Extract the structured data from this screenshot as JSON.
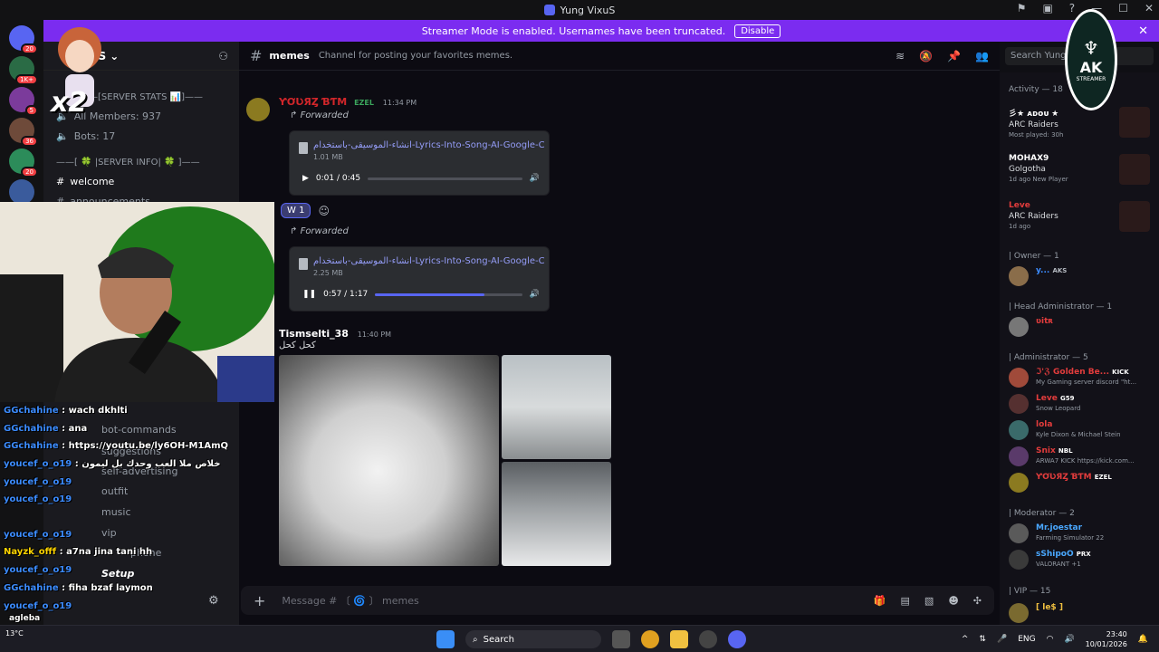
{
  "window": {
    "title": "Yung VixuS"
  },
  "banner": {
    "text": "Streamer Mode is enabled. Usernames have been truncated.",
    "button": "Disable"
  },
  "guilds": [
    {
      "badge": "20",
      "color": "#5865f2"
    },
    {
      "badge": "1K+",
      "color": "#2a6b45"
    },
    {
      "badge": "5",
      "color": "#7b3b9b"
    },
    {
      "badge": "36",
      "color": "#6e4a3a"
    },
    {
      "badge": "20",
      "color": "#2c8c5a"
    },
    {
      "badge": "",
      "color": "#3a5b9c"
    }
  ],
  "sidebar": {
    "server_name": "uS",
    "categories": {
      "server_stats": "—[SERVER STATS 📊]——",
      "server_info": "——[ 🍀 |SERVER INFO| 🍀 ]——"
    },
    "stats": {
      "members": "All Members: 937",
      "bots": "Bots: 17"
    },
    "channels": [
      "welcome",
      "announcements",
      "bot-commands",
      "suggestions",
      "self-advertising",
      "outfit",
      "music",
      "vip",
      "phone",
      "Setup"
    ]
  },
  "channel": {
    "name": "memes",
    "topic": "Channel for posting your favorites memes."
  },
  "search": {
    "placeholder": "Search Yung Vi"
  },
  "messages": [
    {
      "author": "ƳƠƲЯȤ ƁƬM",
      "tag": "EZEL",
      "time": "11:34 PM"
    },
    {
      "author": "Tismselti_38",
      "time": "11:40 PM",
      "text": "كحل كحل"
    }
  ],
  "forwarded_label": "Forwarded",
  "attachments": [
    {
      "name": "انشاء-الموسيقى-باستخدام-Lyrics-Into-Song-AI-Google-Chrom",
      "size": "1.01 MB",
      "time": "0:01 / 0:45",
      "progress": 0.0
    },
    {
      "name": "انشاء-الموسيقى-باستخدام-Lyrics-Into-Song-AI-Google-Chrom",
      "size": "2.25 MB",
      "time": "0:57 / 1:17",
      "progress": 0.74
    }
  ],
  "reaction": {
    "emoji": "W",
    "count": "1"
  },
  "composer": {
    "placeholder": "Message # 〔 🌀 〕 memes"
  },
  "members": {
    "activity_header": "Activity — 18",
    "activities": [
      {
        "name": "彡★ ᴀᴅᴏᴜ ★",
        "game": "ARC Raiders",
        "info": "Most played: 30h"
      },
      {
        "name": "MOHAX9",
        "game": "Golgotha",
        "info": "1d ago  New Player"
      },
      {
        "name": "Leve",
        "game": "ARC Raiders",
        "info": "1d ago"
      }
    ],
    "groups": [
      {
        "title": "| Owner — 1"
      },
      {
        "title": "| Head Administrator — 1"
      },
      {
        "title": "| Administrator — 5"
      },
      {
        "title": "| Moderator — 2"
      },
      {
        "title": "| VIP — 15"
      }
    ],
    "list": [
      {
        "name": "y...",
        "sub": "",
        "tag": "AKS",
        "color": "#3c8cff"
      },
      {
        "name": "ʋitʀ",
        "sub": "",
        "tag": "",
        "color": "#e23c3c"
      },
      {
        "name": "ℑ'ℨ Golden Be...",
        "sub": "My Gaming server discord \"ht...",
        "tag": "KICK",
        "color": "#e23c3c"
      },
      {
        "name": "Leve",
        "sub": "Snow Leopard",
        "tag": "G59",
        "color": "#e23c3c"
      },
      {
        "name": "lola",
        "sub": "Kyle Dixon & Michael Stein",
        "tag": "",
        "color": "#e23c3c"
      },
      {
        "name": "Snix",
        "sub": "ARWA7 KICK https://kick.com...",
        "tag": "NBL",
        "color": "#e23c3c"
      },
      {
        "name": "ƳƠƲЯȤ ƁƬM",
        "sub": "",
        "tag": "EZEL",
        "color": "#e23c3c"
      },
      {
        "name": "Mr.joestar",
        "sub": "Farming Simulator 22",
        "tag": "",
        "color": "#4aa8ff"
      },
      {
        "name": "sShipoO",
        "sub": "VALORANT +1",
        "tag": "PRX",
        "color": "#4aa8ff"
      },
      {
        "name": "[ le$ ]",
        "sub": "",
        "tag": "",
        "color": "#f0c040"
      }
    ]
  },
  "overlay_chat": [
    {
      "user": "GGchahine",
      "text": "wach dkhlti"
    },
    {
      "user": "GGchahine",
      "text": "ana"
    },
    {
      "user": "GGchahine",
      "text": "https://youtu.be/ly6OH-M1AmQ"
    },
    {
      "user": "youcef_o_o19",
      "text": "خلاص ملا العب وحدك بل ليمون"
    },
    {
      "user": "youcef_o_o19",
      "text": ""
    },
    {
      "user": "youcef_o_o19",
      "text": ""
    },
    {
      "user": "youcef_o_o19",
      "text": ""
    },
    {
      "user": "Nayzk_offf",
      "text": "a7na jina tani hh"
    },
    {
      "user": "youcef_o_o19",
      "text": ""
    },
    {
      "user": "GGchahine",
      "text": "fiha bzaf laymon"
    },
    {
      "user": "youcef_o_o19",
      "text": ""
    },
    {
      "user": "youcef_o_o19",
      "text": ""
    }
  ],
  "overlay_extra": {
    "x2": "x2",
    "bottom": "agleba"
  },
  "logo": {
    "big": "AK",
    "small": "STREAMER"
  },
  "taskbar": {
    "search": "Search",
    "lang": "ENG",
    "time": "23:40",
    "date": "10/01/2026",
    "weather": "13°C"
  }
}
